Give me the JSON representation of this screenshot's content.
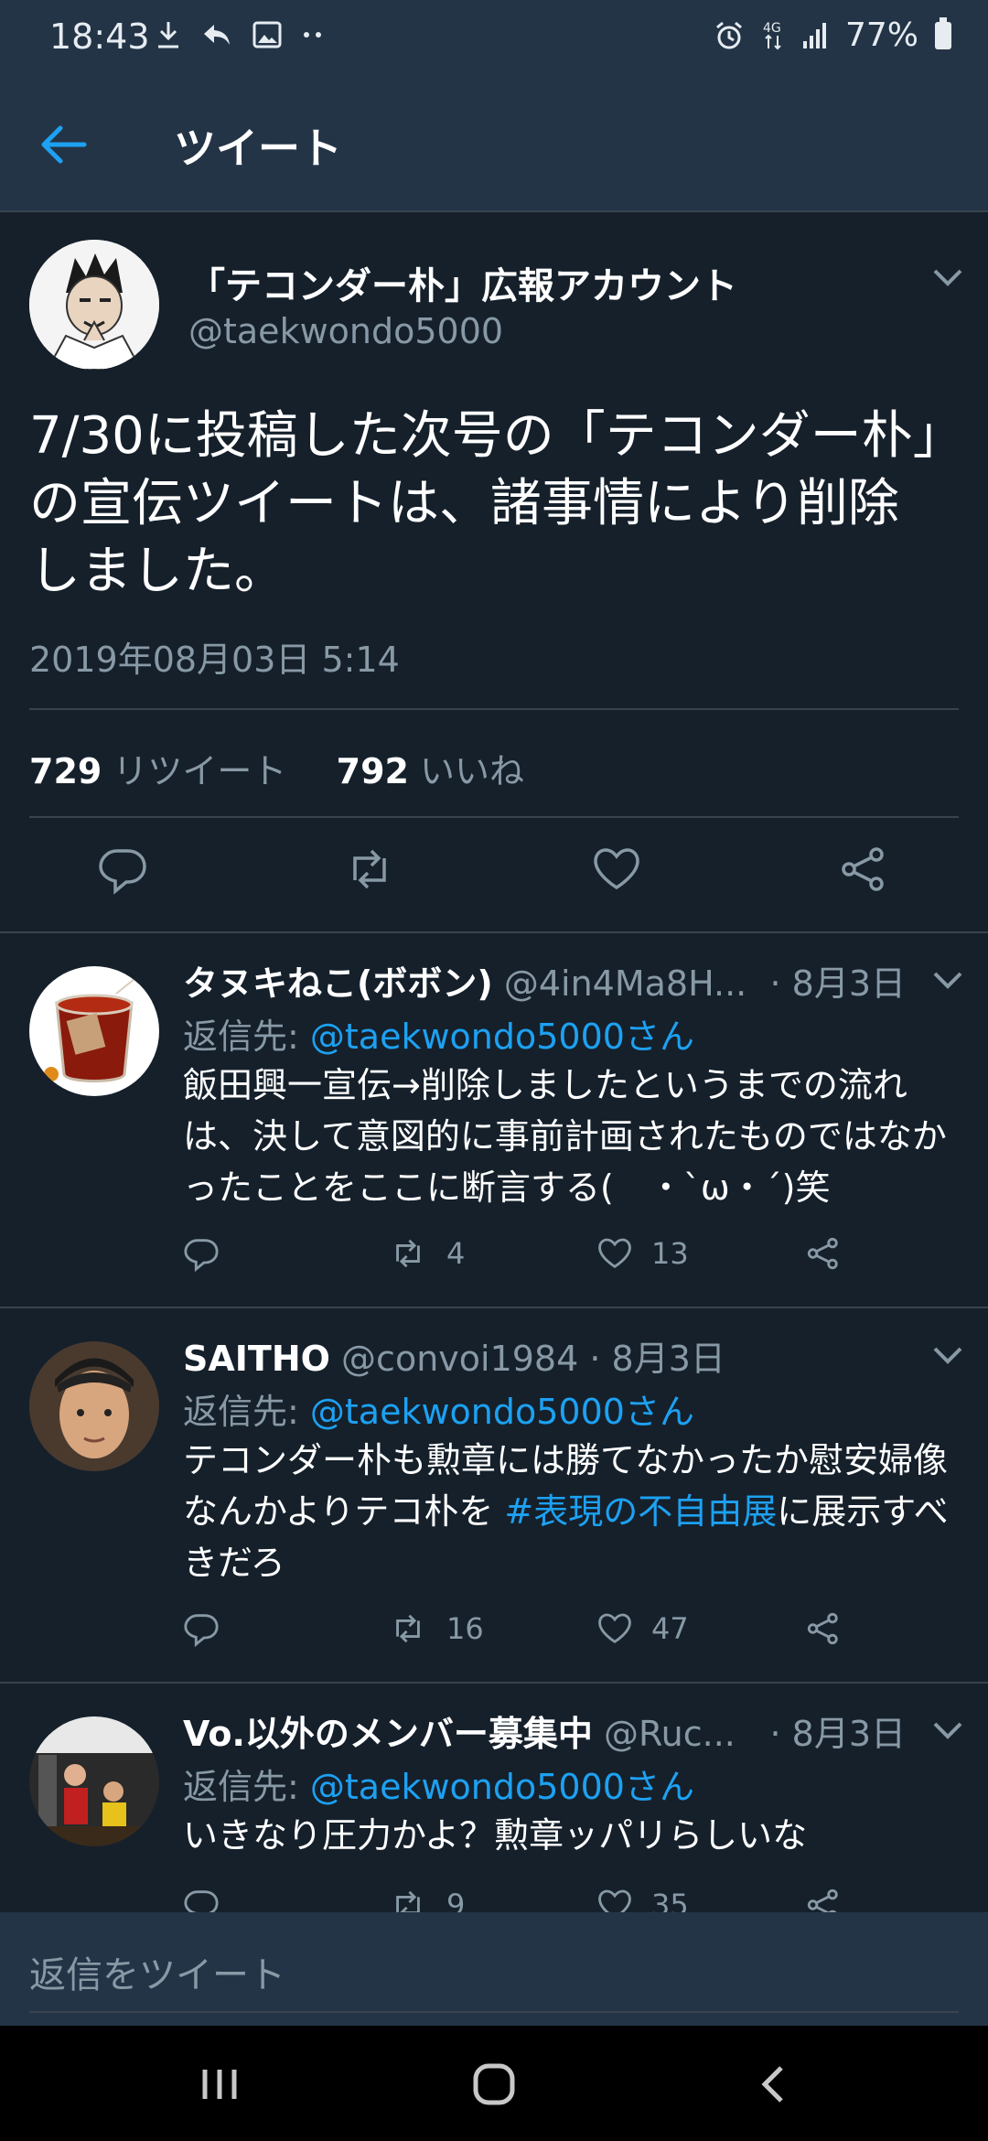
{
  "status_bar": {
    "time": "18:43",
    "battery": "77%",
    "network": "4G"
  },
  "header": {
    "title": "ツイート"
  },
  "main_tweet": {
    "display_name": "「テコンダー朴」広報アカウント",
    "handle": "@taekwondo5000",
    "text": "7/30に投稿した次号の「テコンダー朴」の宣伝ツイートは、諸事情により削除しました。",
    "date": "2019年08月03日 5:14",
    "retweets": "729",
    "retweets_label": "リツイート",
    "likes": "792",
    "likes_label": "いいね"
  },
  "replies": [
    {
      "name": "タヌキねこ(ボボン)",
      "handle": "@4in4Ma8H...",
      "date": "· 8月3日",
      "reply_to_label": "返信先:",
      "reply_to": "@taekwondo5000さん",
      "text": "飯田興一宣伝→削除しましたというまでの流れは、決して意図的に事前計画されたものではなかったことをここに断言する(　・`ω・´)笑",
      "text_after": "",
      "retweets": "4",
      "likes": "13"
    },
    {
      "name": "SAITHO",
      "handle": "@convoi1984 · 8月3日",
      "date": "",
      "reply_to_label": "返信先:",
      "reply_to": "@taekwondo5000さん",
      "text": "テコンダー朴も勲章には勝てなかったか慰安婦像なんかよりテコ朴を ",
      "hashtag": "#表現の不自由展",
      "text_after": "に展示すべきだろ",
      "retweets": "16",
      "likes": "47"
    },
    {
      "name": "Vo.以外のメンバー募集中",
      "handle": "@Ruc...",
      "date": "· 8月3日",
      "reply_to_label": "返信先:",
      "reply_to": "@taekwondo5000さん",
      "text": "いきなり圧力かよ？勲章ッパリらしいな",
      "text_after": "",
      "retweets": "9",
      "likes": "35"
    }
  ],
  "reply_bar": {
    "placeholder": "返信をツイート"
  },
  "colors": {
    "bg": "#15202b",
    "header": "#243447",
    "accent": "#1da1f2",
    "muted": "#8899a6"
  }
}
